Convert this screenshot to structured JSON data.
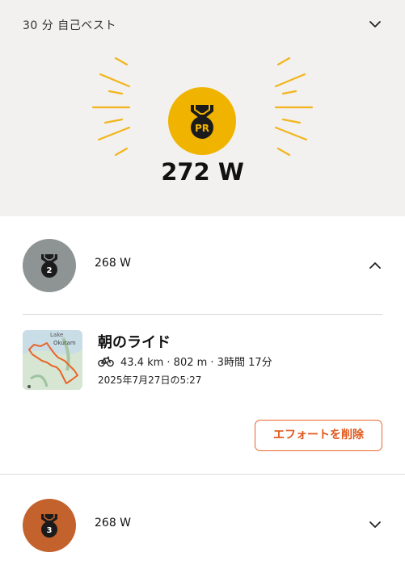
{
  "header": {
    "title": "30 分 自己ベスト",
    "collapse_icon": "chevron-down-icon"
  },
  "best": {
    "badge": "PR",
    "value": "272 W",
    "color": "#f0b400"
  },
  "efforts": [
    {
      "rank": "2",
      "value": "268 W",
      "color": "#8e9494",
      "expanded": true,
      "activity": {
        "title": "朝のライド",
        "stats": "43.4 km · 802 m · 3時間 17分",
        "date": "2025年7月27日の5:27",
        "map_label_1": "Lake",
        "map_label_2": "Okutam",
        "sport_icon": "bike-icon"
      },
      "delete_label": "エフォートを削除"
    },
    {
      "rank": "3",
      "value": "268 W",
      "color": "#c4622d",
      "expanded": false
    }
  ]
}
